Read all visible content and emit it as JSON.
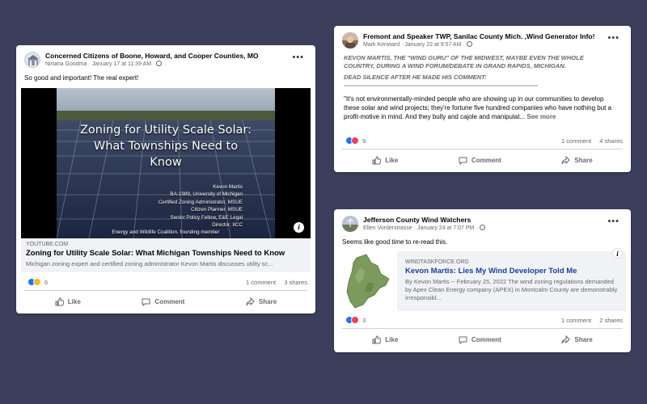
{
  "post1": {
    "page_name": "Concerned Citizens of Boone, Howard, and Cooper Counties, MO",
    "author": "Nirtana Goodma",
    "time": "January 17 at 11:39 AM",
    "text": "So good and important! The real expert!",
    "video": {
      "title_line1": "Zoning for Utility Scale Solar:",
      "title_line2": "What Townships Need to",
      "title_line3": "Know",
      "credits": [
        "Kevon Martis",
        "BA-1989, University of Michigan",
        "Certified Zoning Administrator, MSUE",
        "Citizen Planner, MSUE",
        "Senior Policy Fellow, E&E Legal",
        "Director, IICC",
        "Energy and Wildlife Coalition, founding member"
      ]
    },
    "link": {
      "domain": "YOUTUBE.COM",
      "title": "Zoning for Utility Scale Solar: What Michigan Townships Need to Know",
      "desc": "Michigan zoning expert and certified zoning administrator Kevon Martis discusses utility sc..."
    },
    "reactions": "6",
    "comments": "1 comment",
    "shares": "3 shares"
  },
  "post2": {
    "page_name": "Fremont and Speaker TWP, Sanilac County Mich. ,Wind Generator Info!",
    "author": "Mark Kenward",
    "time": "January 22 at 9:57 AM",
    "caps_line1": "KEVON MARTIS, THE \"WIND GURU\" OF THE MIDWEST, MAYBE EVEN THE WHOLE",
    "caps_line2": "COUNTRY, DURING A WIND FORUM/DEBATE IN GRAND RAPIDS, MICHIGAN.",
    "caps_line3": "DEAD SILENCE AFTER HE MADE HIS COMMENT:",
    "rule": "------------------------------------------------------------------------------------------------",
    "quote": "\"It's not environmentally-minded people who are showing up in our communities to develop these solar and wind projects; they're fortune five hundred companies who have nothing but a profit-motive in mind. And they bully and cajole and manipulat...",
    "see_more": "See more",
    "reactions": "9",
    "comments": "1 comment",
    "shares": "4 shares"
  },
  "post3": {
    "page_name": "Jefferson County Wind Watchers",
    "author": "Ellen Vorderstrasse",
    "time": "January 24 at 7:07 PM",
    "text": "Seems like good time to re-read this.",
    "link": {
      "domain": "WINDTASKFORCE.ORG",
      "title": "Kevon Martis: Lies My Wind Developer Told Me",
      "desc": "By Kevon Martis -- February 25, 2022 The wind zoning regulations demanded by Apex Clean Energy company (APEX) in Montcalm County are demonstrably irresponsibl..."
    },
    "reactions": "3",
    "comments": "1 comment",
    "shares": "2 shares"
  },
  "actions": {
    "like": "Like",
    "comment": "Comment",
    "share": "Share"
  },
  "more": "•••",
  "info": "i",
  "separator": "·",
  "colors": {
    "background": "#3b3f5c",
    "link_title": "#1c3fa0",
    "like_blue": "#1877f2"
  }
}
